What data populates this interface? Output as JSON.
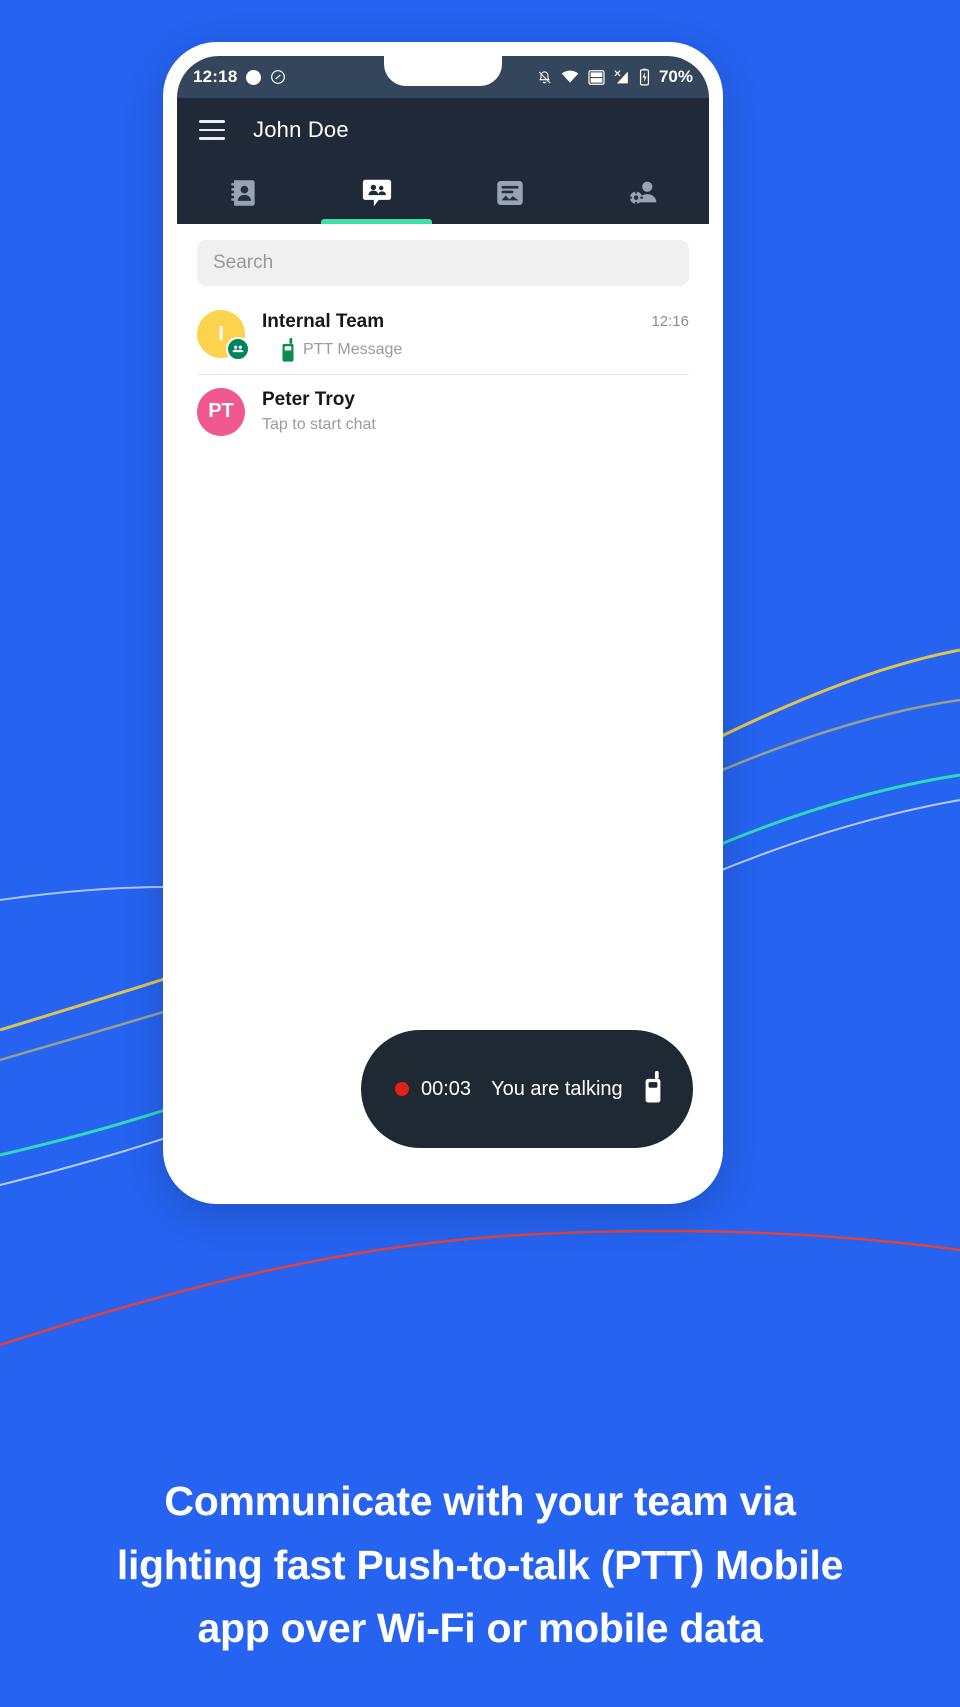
{
  "background": {
    "color": "#2563f0"
  },
  "phone": {
    "status_bar": {
      "time": "12:18",
      "battery_percent": "70%",
      "icons": [
        "record-dot-icon",
        "do-not-disturb-icon",
        "notifications-muted-icon",
        "wifi-icon",
        "volte-wifi-icon",
        "cellular-signal-off-icon",
        "battery-charging-icon"
      ]
    },
    "app_bar": {
      "menu_icon": "hamburger-menu-icon",
      "title": "John Doe",
      "tabs": [
        {
          "id": "contacts",
          "icon": "contacts-book-icon",
          "label": "Contacts",
          "active": false
        },
        {
          "id": "chats",
          "icon": "group-chat-icon",
          "label": "Chats",
          "active": true
        },
        {
          "id": "channels",
          "icon": "channels-icon",
          "label": "Channels",
          "active": false
        },
        {
          "id": "account",
          "icon": "account-settings-icon",
          "label": "Account",
          "active": false
        }
      ],
      "active_indicator_color": "#3ee0a6"
    },
    "search": {
      "placeholder": "Search",
      "value": ""
    },
    "chats": [
      {
        "name": "Internal Team",
        "preview": "PTT Message",
        "preview_icon": "walkie-talkie-icon",
        "time": "12:16",
        "avatar_initials": "I",
        "avatar_color": "#fcd34d",
        "is_group": true,
        "group_badge_icon": "group-icon"
      },
      {
        "name": "Peter Troy",
        "preview": "Tap to start chat",
        "preview_icon": "",
        "time": "",
        "avatar_initials": "PT",
        "avatar_color": "#f0588f",
        "is_group": false,
        "group_badge_icon": ""
      }
    ],
    "ptt_indicator": {
      "timer": "00:03",
      "status": "You are talking",
      "record_dot_color": "#e2211c",
      "mic_icon": "walkie-talkie-icon",
      "background": "#1f2933"
    }
  },
  "caption": {
    "text": "Communicate with your team via lighting fast Push-to-talk (PTT) Mobile app over Wi-Fi or mobile data"
  }
}
